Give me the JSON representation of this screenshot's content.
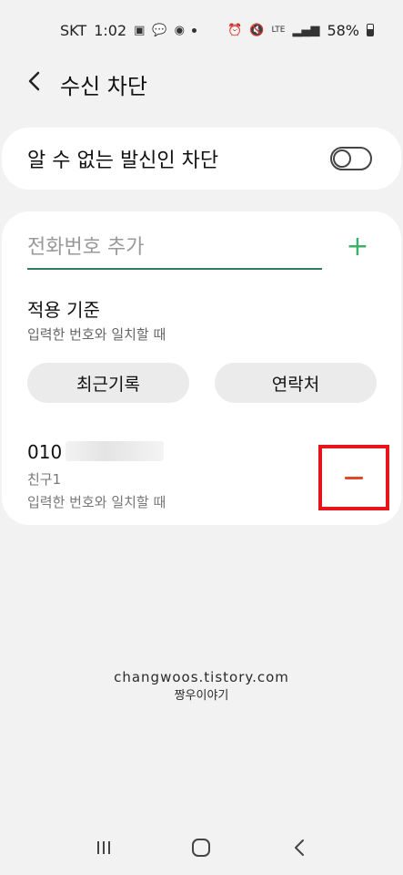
{
  "status_bar": {
    "carrier": "SKT",
    "time": "1:02",
    "network": "LTE",
    "battery": "58%"
  },
  "header": {
    "title": "수신 차단"
  },
  "unknown_caller": {
    "label": "알 수 없는 발신인 차단",
    "enabled": false
  },
  "add_number": {
    "placeholder": "전화번호 추가",
    "add_symbol": "+"
  },
  "criteria": {
    "title": "적용 기준",
    "subtitle": "입력한 번호와 일치할 때"
  },
  "buttons": {
    "recent_logs": "최근기록",
    "contacts": "연락처"
  },
  "blocked_list": [
    {
      "number_visible": "010",
      "name": "친구1",
      "rule": "입력한 번호와 일치할 때"
    }
  ],
  "watermark": {
    "line1": "changwoos.tistory.com",
    "line2": "짱우이야기"
  },
  "colors": {
    "accent_green": "#3bb06a",
    "underline_green": "#2f7d5d",
    "remove_red": "#e1492a",
    "highlight_frame": "#e8141b"
  }
}
